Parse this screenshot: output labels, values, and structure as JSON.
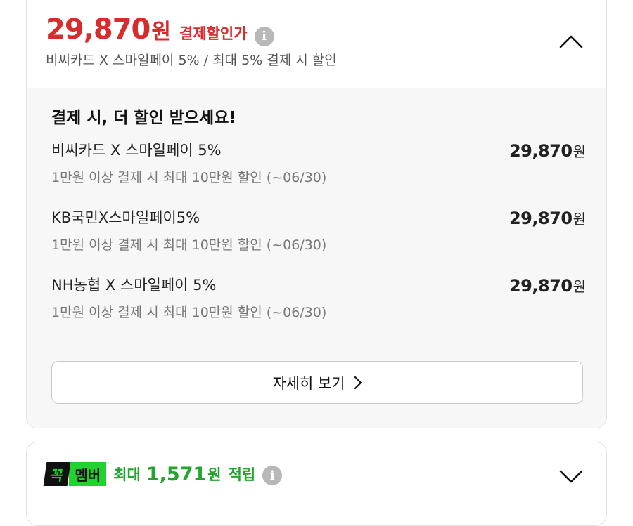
{
  "price_card": {
    "price": "29,870",
    "unit": "원",
    "label": "결제할인가",
    "subtitle": "비씨카드 X 스마일페이 5%  / 최대 5% 결제 시 할인",
    "info_icon": "info-icon",
    "toggle_icon": "chevron-up-icon"
  },
  "benefits": {
    "title": "결제 시, 더 할인 받으세요!",
    "offers": [
      {
        "name": "비씨카드 X 스마일페이 5%",
        "desc": "1만원 이상 결제 시 최대 10만원 할인 (~06/30)",
        "price": "29,870",
        "unit": "원"
      },
      {
        "name": "KB국민X스마일페이5%",
        "desc": "1만원 이상 결제 시 최대 10만원 할인 (~06/30)",
        "price": "29,870",
        "unit": "원"
      },
      {
        "name": "NH농협 X 스마일페이 5%",
        "desc": "1만원 이상 결제 시 최대 10만원 할인 (~06/30)",
        "price": "29,870",
        "unit": "원"
      }
    ],
    "detail_button": "자세히 보기",
    "detail_icon": "chevron-right-icon"
  },
  "member_card": {
    "logo_left": "꼭",
    "logo_right": "멤버",
    "prefix": "최대",
    "points": "1,571",
    "unit": "원",
    "suffix": "적립",
    "info_icon": "info-icon",
    "toggle_icon": "chevron-down-icon"
  },
  "colors": {
    "accent_red": "#d92b2b",
    "member_green": "#22a52c",
    "logo_green": "#22d231"
  }
}
